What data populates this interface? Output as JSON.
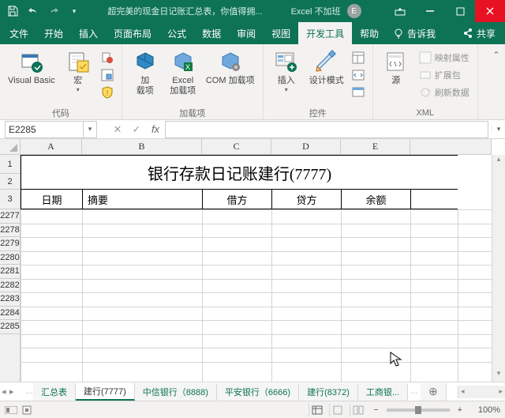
{
  "titlebar": {
    "doc_title": "超完美的现金日记账汇总表，你值得拥...",
    "app": "Excel 不加班",
    "user_initial": "E"
  },
  "tabs": {
    "file": "文件",
    "home": "开始",
    "insert": "插入",
    "layout": "页面布局",
    "formulas": "公式",
    "data": "数据",
    "review": "审阅",
    "view": "视图",
    "developer": "开发工具",
    "help": "帮助",
    "tellme": "告诉我",
    "share": "共享"
  },
  "ribbon": {
    "code": {
      "vb": "Visual Basic",
      "macros": "宏",
      "label": "代码"
    },
    "addins": {
      "addins": "加\n载项",
      "excel": "Excel\n加载项",
      "com": "COM 加载项",
      "label": "加载项"
    },
    "controls": {
      "insert": "插入",
      "design": "设计模式",
      "label": "控件"
    },
    "xml": {
      "source": "源",
      "map": "映射属性",
      "expand": "扩展包",
      "refresh": "刷新数据",
      "label": "XML"
    }
  },
  "namebox": {
    "ref": "E2285"
  },
  "cols": {
    "A": "A",
    "B": "B",
    "C": "C",
    "D": "D",
    "E": "E"
  },
  "col_widths": {
    "A": 78,
    "B": 152,
    "C": 88,
    "D": 88,
    "E": 88,
    "F": 60
  },
  "rows": [
    "1",
    "2",
    "3",
    "2277",
    "2278",
    "2279",
    "2280",
    "2281",
    "2282",
    "2283",
    "2284",
    "2285"
  ],
  "sheet": {
    "title": "银行存款日记账建行(7777)",
    "h_date": "日期",
    "h_summary": "摘要",
    "h_debit": "借方",
    "h_credit": "贷方",
    "h_balance": "余额"
  },
  "tabsheets": {
    "t1": "汇总表",
    "t2": "建行(7777)",
    "t3": "中信银行（8888)",
    "t4": "平安银行（6666)",
    "t5": "建行(8372)",
    "t6": "工商银..."
  },
  "status": {
    "zoom": "100%",
    "plus": "+",
    "minus": "−"
  }
}
